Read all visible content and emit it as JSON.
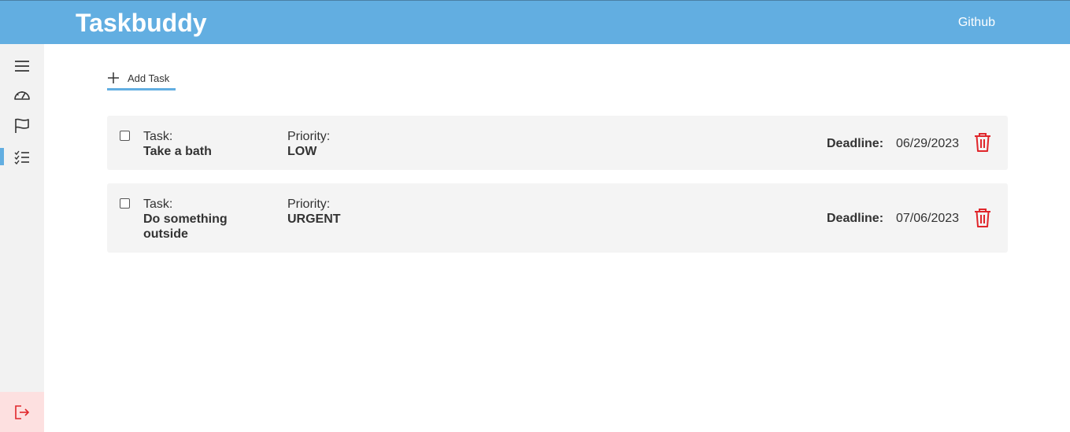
{
  "app": {
    "title": "Taskbuddy",
    "github_label": "Github"
  },
  "colors": {
    "header": "#62aee1",
    "danger": "#e0262b",
    "card": "#f4f4f4",
    "sidebar": "#f2f2f2",
    "logout_bg": "#fde0e0"
  },
  "sidebar": {
    "items": [
      {
        "icon": "menu-icon"
      },
      {
        "icon": "dashboard-gauge-icon"
      },
      {
        "icon": "flag-icon"
      },
      {
        "icon": "checklist-icon",
        "active": true
      }
    ],
    "logout_icon": "logout-icon"
  },
  "toolbar": {
    "add_task_label": "Add Task"
  },
  "tasks": [
    {
      "task_label": "Task:",
      "task_name_line1": "Take a bath",
      "task_name_line2": "",
      "priority_label": "Priority:",
      "priority": "LOW",
      "deadline_label": "Deadline:",
      "deadline": "06/29/2023",
      "checked": false
    },
    {
      "task_label": "Task:",
      "task_name_line1": "Do something",
      "task_name_line2": "outside",
      "priority_label": "Priority:",
      "priority": "URGENT",
      "deadline_label": "Deadline:",
      "deadline": "07/06/2023",
      "checked": false
    }
  ]
}
